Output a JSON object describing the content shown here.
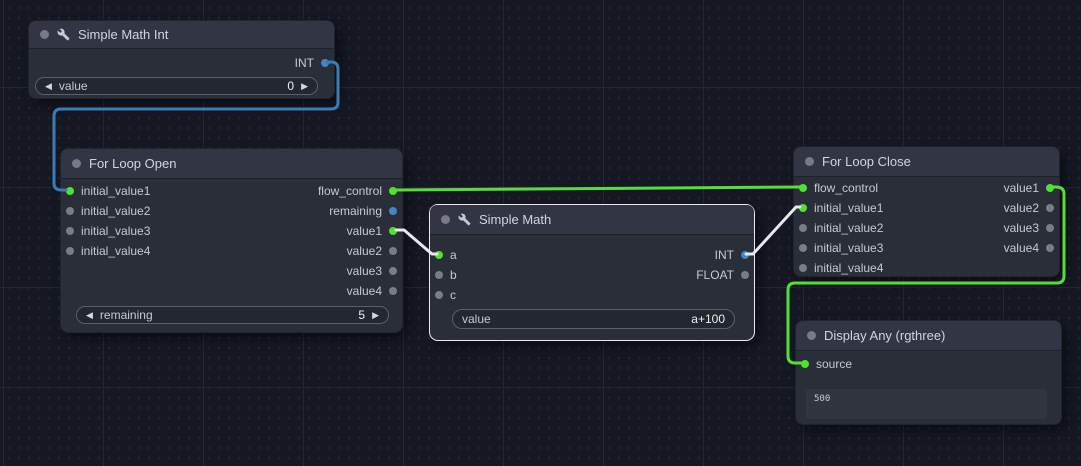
{
  "palette": {
    "green": "#4fe32f",
    "blue": "#4186c7",
    "gray": "#787e89",
    "green_wire": "#57dd37",
    "blue_wire": "#3a7cb5",
    "white_wire": "#e7e9ec",
    "node_bg": "#2a2e38",
    "node_header": "#323644",
    "canvas_bg": "#151823",
    "selected_border": "#e8eaee"
  },
  "nodes": {
    "simple_math_int": {
      "title": "Simple Math Int",
      "outputs": [
        {
          "label": "INT",
          "color": "blue"
        }
      ],
      "widget": {
        "label": "value",
        "value": "0"
      }
    },
    "for_loop_open": {
      "title": "For Loop Open",
      "inputs": [
        {
          "label": "initial_value1",
          "color": "green"
        },
        {
          "label": "initial_value2",
          "color": "gray"
        },
        {
          "label": "initial_value3",
          "color": "gray"
        },
        {
          "label": "initial_value4",
          "color": "gray"
        }
      ],
      "outputs": [
        {
          "label": "flow_control",
          "color": "green"
        },
        {
          "label": "remaining",
          "color": "blue"
        },
        {
          "label": "value1",
          "color": "green"
        },
        {
          "label": "value2",
          "color": "gray"
        },
        {
          "label": "value3",
          "color": "gray"
        },
        {
          "label": "value4",
          "color": "gray"
        }
      ],
      "widget": {
        "label": "remaining",
        "value": "5"
      }
    },
    "simple_math": {
      "title": "Simple Math",
      "selected": true,
      "inputs": [
        {
          "label": "a",
          "color": "green"
        },
        {
          "label": "b",
          "color": "gray"
        },
        {
          "label": "c",
          "color": "gray"
        }
      ],
      "outputs": [
        {
          "label": "INT",
          "color": "blue"
        },
        {
          "label": "FLOAT",
          "color": "gray"
        }
      ],
      "widget": {
        "label": "value",
        "value": "a+100"
      }
    },
    "for_loop_close": {
      "title": "For Loop Close",
      "inputs": [
        {
          "label": "flow_control",
          "color": "green"
        },
        {
          "label": "initial_value1",
          "color": "green"
        },
        {
          "label": "initial_value2",
          "color": "gray"
        },
        {
          "label": "initial_value3",
          "color": "gray"
        },
        {
          "label": "initial_value4",
          "color": "gray"
        }
      ],
      "outputs": [
        {
          "label": "value1",
          "color": "green"
        },
        {
          "label": "value2",
          "color": "gray"
        },
        {
          "label": "value3",
          "color": "gray"
        },
        {
          "label": "value4",
          "color": "gray"
        }
      ]
    },
    "display_any": {
      "title": "Display Any (rgthree)",
      "inputs": [
        {
          "label": "source",
          "color": "green"
        }
      ],
      "display_text": "500"
    }
  },
  "widget_arrows": {
    "left": "◀",
    "right": "▶"
  }
}
